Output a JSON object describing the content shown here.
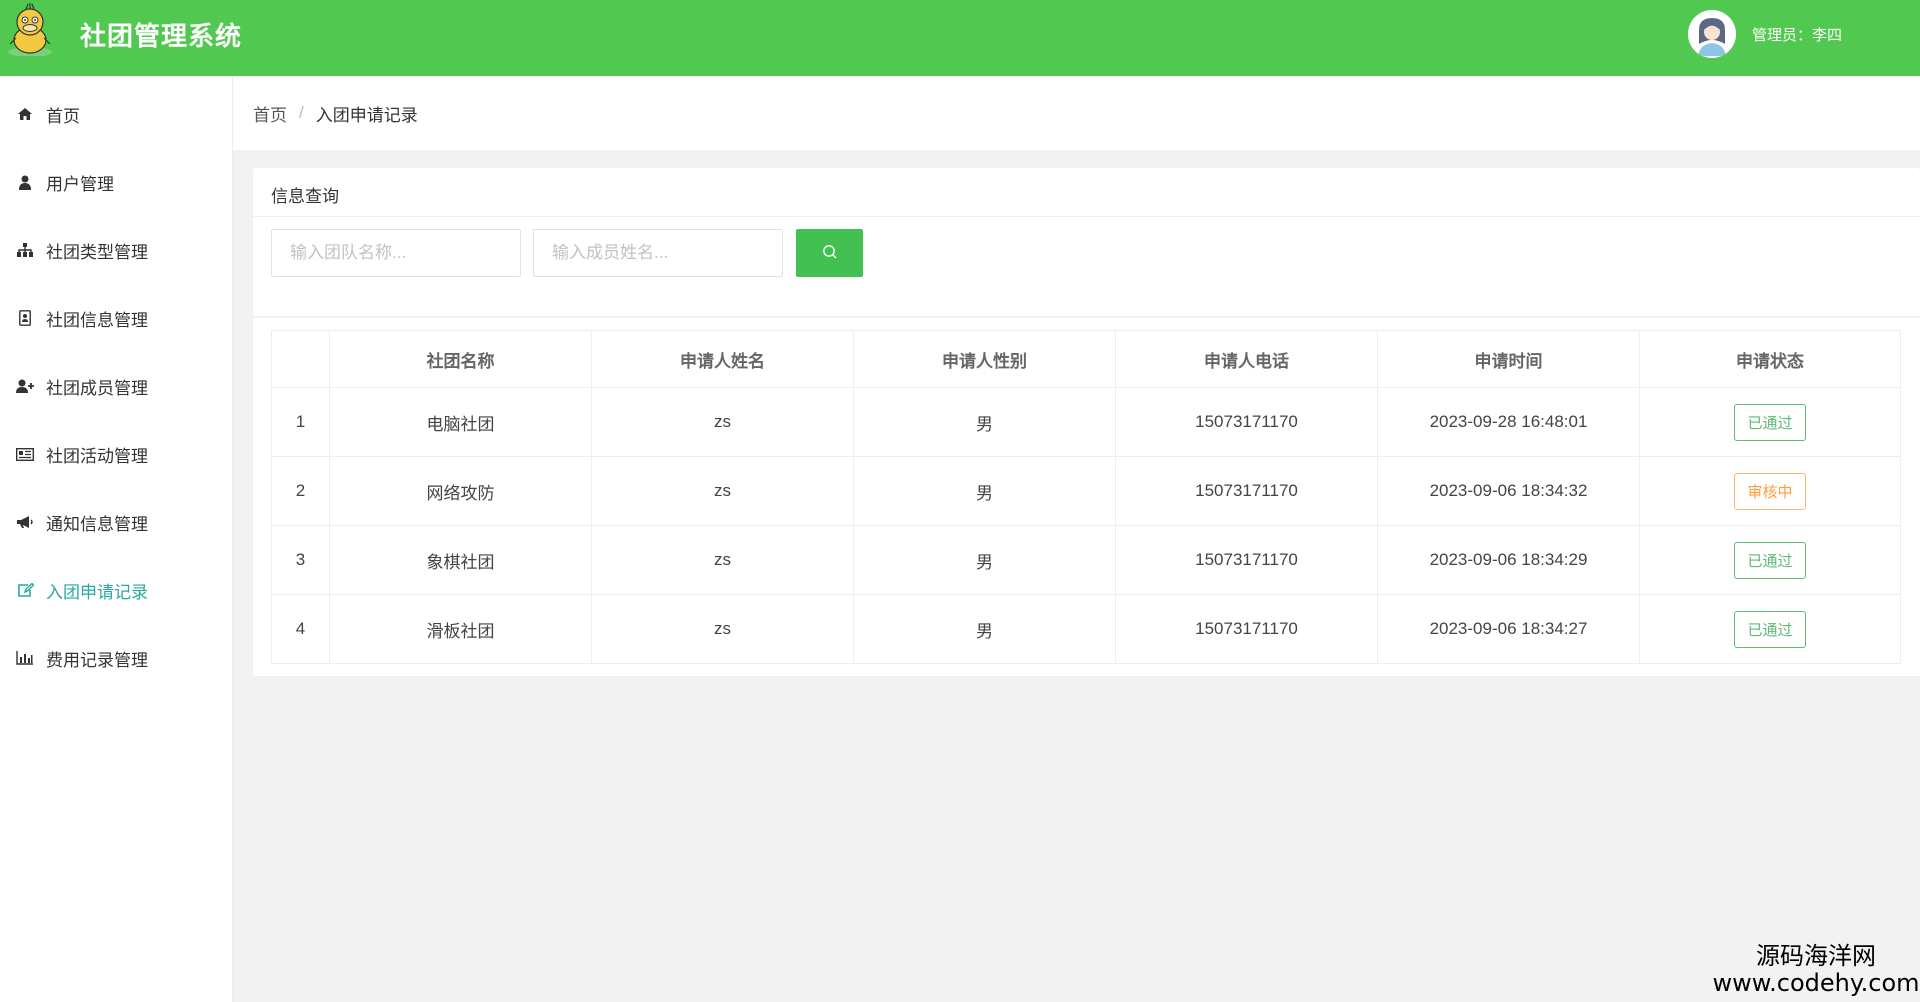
{
  "header": {
    "title": "社团管理系统",
    "admin_label": "管理员：李四",
    "logo_icon": "duck-mascot-icon",
    "avatar_icon": "user-avatar-icon",
    "bg_color": "#51c84f"
  },
  "sidebar": {
    "items": [
      {
        "label": "首页",
        "icon": "home-icon"
      },
      {
        "label": "用户管理",
        "icon": "user-icon"
      },
      {
        "label": "社团类型管理",
        "icon": "sitemap-icon"
      },
      {
        "label": "社团信息管理",
        "icon": "id-card-icon"
      },
      {
        "label": "社团成员管理",
        "icon": "user-plus-icon"
      },
      {
        "label": "社团活动管理",
        "icon": "newspaper-icon"
      },
      {
        "label": "通知信息管理",
        "icon": "bullhorn-icon"
      },
      {
        "label": "入团申请记录",
        "icon": "edit-icon",
        "active": true
      },
      {
        "label": "费用记录管理",
        "icon": "bar-chart-icon"
      }
    ],
    "active_color": "#2aa8a0"
  },
  "breadcrumb": {
    "home": "首页",
    "separator": "/",
    "current": "入团申请记录"
  },
  "query": {
    "title": "信息查询",
    "team_placeholder": "输入团队名称...",
    "member_placeholder": "输入成员姓名...",
    "search_icon": "search-icon"
  },
  "table": {
    "headers": [
      "",
      "社团名称",
      "申请人姓名",
      "申请人性别",
      "申请人电话",
      "申请时间",
      "申请状态"
    ],
    "rows": [
      {
        "idx": "1",
        "club": "电脑社团",
        "name": "zs",
        "gender": "男",
        "phone": "15073171170",
        "time": "2023-09-28 16:48:01",
        "status": "已通过",
        "status_type": "ok"
      },
      {
        "idx": "2",
        "club": "网络攻防",
        "name": "zs",
        "gender": "男",
        "phone": "15073171170",
        "time": "2023-09-06 18:34:32",
        "status": "审核中",
        "status_type": "pending"
      },
      {
        "idx": "3",
        "club": "象棋社团",
        "name": "zs",
        "gender": "男",
        "phone": "15073171170",
        "time": "2023-09-06 18:34:29",
        "status": "已通过",
        "status_type": "ok"
      },
      {
        "idx": "4",
        "club": "滑板社团",
        "name": "zs",
        "gender": "男",
        "phone": "15073171170",
        "time": "2023-09-06 18:34:27",
        "status": "已通过",
        "status_type": "ok"
      }
    ]
  },
  "watermark": {
    "line1": "源码海洋网",
    "line2": "www.codehy.com"
  }
}
